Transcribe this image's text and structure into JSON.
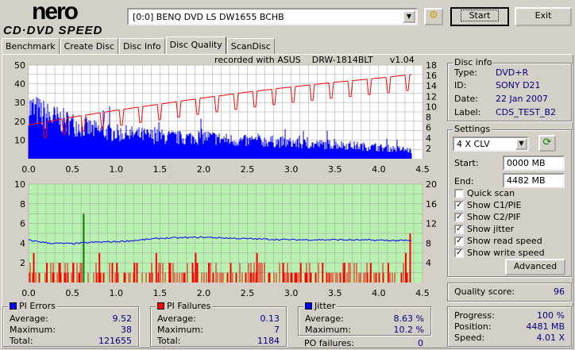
{
  "app": {
    "logo_top": "nero",
    "logo_bottom": "CD·DVD SPEED"
  },
  "toolbar": {
    "drive": "[0:0]  BENQ DVD LS DW1655 BCHB",
    "start": "Start",
    "exit": "Exit",
    "eject_icon": "disc-eject-icon"
  },
  "tabs": [
    {
      "label": "Benchmark"
    },
    {
      "label": "Create Disc"
    },
    {
      "label": "Disc Info"
    },
    {
      "label": "Disc Quality",
      "active": true
    },
    {
      "label": "ScanDisc"
    }
  ],
  "recorded": {
    "text": "recorded with ASUS",
    "drive": "DRW-1814BLT",
    "version": "v1.04"
  },
  "disc_info": {
    "title": "Disc info",
    "type_label": "Type:",
    "type": "DVD+R",
    "id_label": "ID:",
    "id": "SONY D21",
    "date_label": "Date:",
    "date": "22 Jan 2007",
    "label_label": "Label:",
    "label": "CDS_TEST_B2"
  },
  "settings": {
    "title": "Settings",
    "speed": "4 X CLV",
    "start_label": "Start:",
    "start": "0000 MB",
    "end_label": "End:",
    "end": "4482 MB",
    "checks": [
      {
        "label": "Quick scan",
        "checked": false
      },
      {
        "label": "Show C1/PIE",
        "checked": true
      },
      {
        "label": "Show C2/PIF",
        "checked": true
      },
      {
        "label": "Show jitter",
        "checked": true
      },
      {
        "label": "Show read speed",
        "checked": true
      },
      {
        "label": "Show write speed",
        "checked": true
      }
    ],
    "advanced": "Advanced"
  },
  "quality": {
    "label": "Quality score:",
    "value": "96"
  },
  "progress": {
    "progress_label": "Progress:",
    "progress": "100 %",
    "position_label": "Position:",
    "position": "4481 MB",
    "speed_label": "Speed:",
    "speed": "4.01 X"
  },
  "pi_errors": {
    "title": "PI Errors",
    "color": "#0000ff",
    "average_label": "Average:",
    "average": "9.52",
    "maximum_label": "Maximum:",
    "maximum": "38",
    "total_label": "Total:",
    "total": "121655"
  },
  "pi_failures": {
    "title": "PI Failures",
    "color": "#ff0000",
    "average_label": "Average:",
    "average": "0.13",
    "maximum_label": "Maximum:",
    "maximum": "7",
    "total_label": "Total:",
    "total": "1184"
  },
  "jitter": {
    "title": "Jitter",
    "color": "#0000ff",
    "average_label": "Average:",
    "average": "8.63 %",
    "maximum_label": "Maximum:",
    "maximum": "10.2 %",
    "po_label": "PO failures:",
    "po": "0"
  },
  "chart_data": [
    {
      "type": "bar",
      "name": "PI Errors / read speed",
      "xlim": [
        0,
        4.5
      ],
      "ylim_left": [
        0,
        50
      ],
      "ylim_right": [
        0,
        18
      ],
      "x_ticks": [
        "0.0",
        "0.5",
        "1.0",
        "1.5",
        "2.0",
        "2.5",
        "3.0",
        "3.5",
        "4.0",
        "4.5"
      ],
      "y_ticks_left": [
        "10",
        "20",
        "30",
        "40",
        "50"
      ],
      "y_ticks_right": [
        "2",
        "4",
        "6",
        "8",
        "10",
        "12",
        "14",
        "16",
        "18"
      ],
      "grid": true,
      "pi_x": [
        0,
        0.25,
        0.5,
        0.75,
        1.0,
        1.25,
        1.5,
        1.75,
        2.0,
        2.25,
        2.5,
        2.75,
        3.0,
        3.25,
        3.5,
        3.75,
        4.0,
        4.25,
        4.38
      ],
      "pi_values": [
        32,
        26,
        22,
        18,
        16,
        15,
        14,
        13,
        14,
        12,
        11,
        11,
        10,
        9,
        9,
        8,
        7,
        6,
        5
      ],
      "speed_x": [
        0,
        0.5,
        1.0,
        1.5,
        2.0,
        2.5,
        3.0,
        3.5,
        4.0,
        4.38
      ],
      "speed_values": [
        6.5,
        8,
        9.3,
        10.5,
        11.7,
        12.8,
        13.8,
        14.7,
        15.5,
        16.2
      ]
    },
    {
      "type": "bar",
      "name": "PI Failures / jitter",
      "xlim": [
        0,
        4.5
      ],
      "ylim_left": [
        0,
        10
      ],
      "ylim_right": [
        0,
        20
      ],
      "x_ticks": [
        "0.0",
        "0.5",
        "1.0",
        "1.5",
        "2.0",
        "2.5",
        "3.0",
        "3.5",
        "4.0",
        "4.5"
      ],
      "y_ticks_left": [
        "2",
        "4",
        "6",
        "8",
        "10"
      ],
      "y_ticks_right": [
        "4",
        "8",
        "12",
        "16",
        "20"
      ],
      "grid": true,
      "pif_x": [
        0.05,
        0.2,
        0.35,
        0.5,
        0.62,
        0.8,
        1.0,
        1.2,
        1.45,
        1.6,
        1.9,
        2.05,
        2.3,
        2.6,
        2.9,
        3.1,
        3.35,
        3.6,
        3.9,
        4.1,
        4.3,
        4.35
      ],
      "pif_values": [
        3,
        2,
        2,
        2,
        7,
        3,
        2,
        2,
        3,
        2,
        3,
        2,
        2,
        3,
        2,
        2,
        2,
        2,
        2,
        2,
        3,
        5
      ],
      "jitter_x": [
        0,
        0.25,
        0.5,
        0.75,
        1.0,
        1.25,
        1.5,
        2.0,
        2.5,
        3.0,
        3.5,
        4.0,
        4.38
      ],
      "jitter_values": [
        8.6,
        8.0,
        7.9,
        8.2,
        8.3,
        8.6,
        9.0,
        9.2,
        8.9,
        8.7,
        8.7,
        8.6,
        8.5
      ]
    }
  ]
}
